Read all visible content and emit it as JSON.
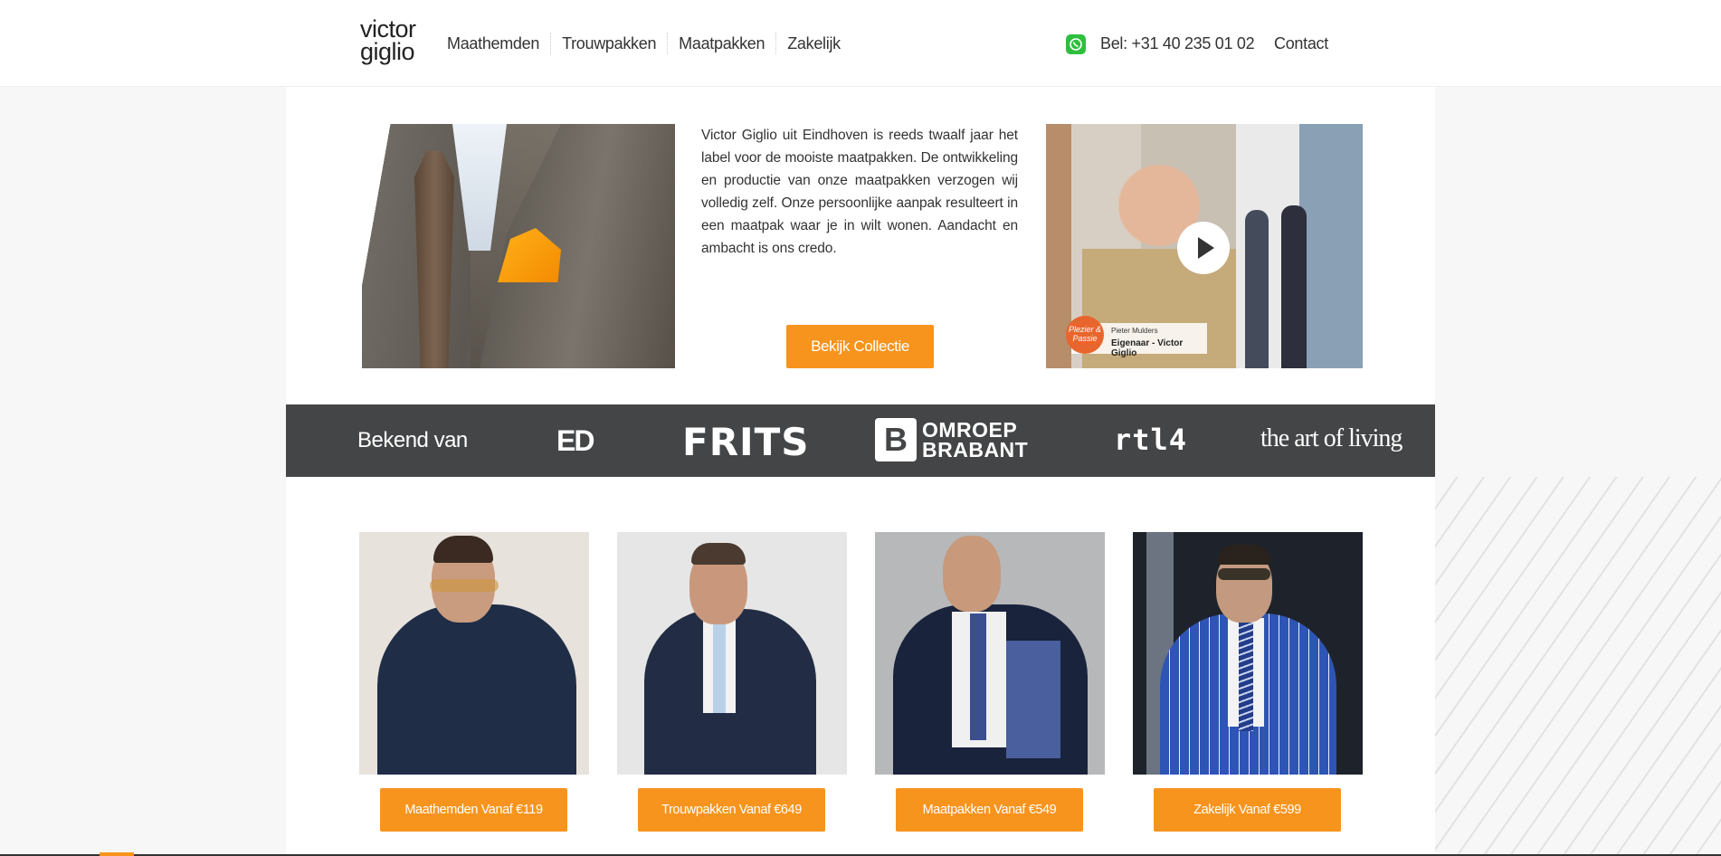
{
  "header": {
    "logo_line1": "victor",
    "logo_line2": "giglio",
    "nav": [
      "Maathemden",
      "Trouwpakken",
      "Maatpakken",
      "Zakelijk"
    ],
    "phone": "Bel: +31 40 235 01 02",
    "contact": "Contact"
  },
  "intro": {
    "text": "Victor Giglio uit Eindhoven is reeds twaalf jaar het label voor de mooiste maatpakken. De ontwikkeling en productie van onze maatpakken verzogen wij volledig zelf. Onze persoonlijke aanpak resulteert in een maatpak waar je in wilt wonen. Aandacht en ambacht is ons credo.",
    "cta": "Bekijk Collectie"
  },
  "video": {
    "badge": "Plezier & Passie",
    "name": "Pieter Mulders",
    "title": "Eigenaar - Victor Giglio"
  },
  "press": {
    "label": "Bekend van",
    "logos": {
      "ed": "ED",
      "frits": "FRITS",
      "omroep_b": "B",
      "omroep_line1": "OMROEP",
      "omroep_line2": "BRABANT",
      "rtl": "rtl4",
      "aol": "the art of living"
    }
  },
  "products": [
    {
      "label": "Maathemden Vanaf €119"
    },
    {
      "label": "Trouwpakken Vanaf €649"
    },
    {
      "label": "Maatpakken Vanaf €549"
    },
    {
      "label": "Zakelijk Vanaf €599"
    }
  ],
  "colors": {
    "accent": "#f7941d",
    "press_bg": "#444546",
    "whatsapp": "#2fbf3f"
  }
}
